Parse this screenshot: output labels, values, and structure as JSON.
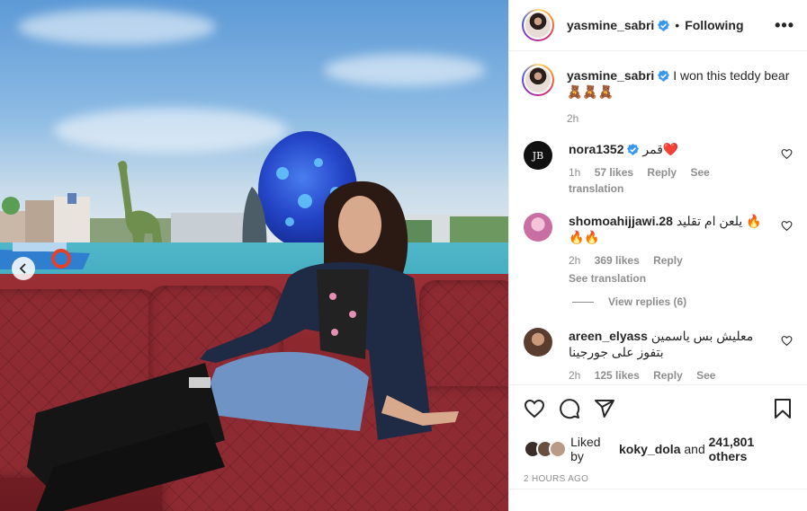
{
  "post": {
    "author": "yasmine_sabri",
    "follow_state": "Following",
    "more": "•••",
    "caption": "I won this teddy bear 🧸🧸🧸",
    "caption_time": "2h"
  },
  "comments": [
    {
      "user": "nora1352",
      "verified": true,
      "text": "قمر❤️",
      "time": "1h",
      "likes": "57 likes",
      "reply": "Reply",
      "translate": "See translation",
      "avatar_color": "#111111"
    },
    {
      "user": "shomoahijjawi.28",
      "verified": false,
      "text": "يلعن ام تقليد 🔥🔥🔥",
      "time": "2h",
      "likes": "369 likes",
      "reply": "Reply",
      "translate": "See translation",
      "avatar_color": "#d9a7c7",
      "view_replies": "View replies (6)"
    },
    {
      "user": "areen_elyass",
      "verified": false,
      "text_line1": "معليش بس ياسمين",
      "text_line2": "بتفوز على جورجينا",
      "time": "2h",
      "likes": "125 likes",
      "reply": "Reply",
      "translate": "See translation",
      "avatar_color": "#6b4b3a"
    }
  ],
  "likes": {
    "prefix": "Liked by",
    "user": "koky_dola",
    "conj": "and",
    "others": "241,801 others"
  },
  "timestamp": "2 HOURS AGO",
  "icons": {
    "like": "heart-icon",
    "comment": "comment-icon",
    "share": "share-icon",
    "save": "bookmark-icon",
    "verified": "verified-badge-icon",
    "carousel_prev": "chevron-left-icon"
  },
  "colors": {
    "verified": "#3897f0",
    "heart_red": "#c0111f",
    "muted": "#8e8e8e",
    "text": "#262626"
  }
}
